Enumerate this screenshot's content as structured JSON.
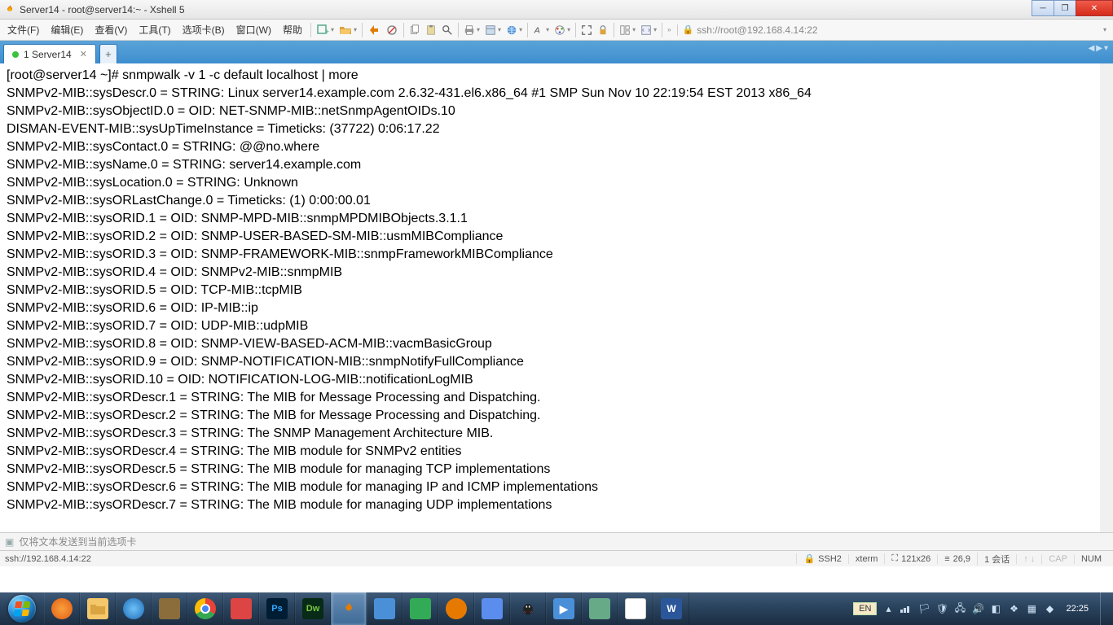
{
  "title": "Server14 - root@server14:~ - Xshell 5",
  "menus": [
    "文件(F)",
    "编辑(E)",
    "查看(V)",
    "工具(T)",
    "选项卡(B)",
    "窗口(W)",
    "帮助"
  ],
  "address": "ssh://root@192.168.4.14:22",
  "tab": {
    "label": "1 Server14"
  },
  "terminal": {
    "prompt": "[root@server14 ~]# ",
    "command": "snmpwalk -v 1 -c default localhost | more",
    "lines": [
      "SNMPv2-MIB::sysDescr.0 = STRING: Linux server14.example.com 2.6.32-431.el6.x86_64 #1 SMP Sun Nov 10 22:19:54 EST 2013 x86_64",
      "SNMPv2-MIB::sysObjectID.0 = OID: NET-SNMP-MIB::netSnmpAgentOIDs.10",
      "DISMAN-EVENT-MIB::sysUpTimeInstance = Timeticks: (37722) 0:06:17.22",
      "SNMPv2-MIB::sysContact.0 = STRING: @@no.where",
      "SNMPv2-MIB::sysName.0 = STRING: server14.example.com",
      "SNMPv2-MIB::sysLocation.0 = STRING: Unknown",
      "SNMPv2-MIB::sysORLastChange.0 = Timeticks: (1) 0:00:00.01",
      "SNMPv2-MIB::sysORID.1 = OID: SNMP-MPD-MIB::snmpMPDMIBObjects.3.1.1",
      "SNMPv2-MIB::sysORID.2 = OID: SNMP-USER-BASED-SM-MIB::usmMIBCompliance",
      "SNMPv2-MIB::sysORID.3 = OID: SNMP-FRAMEWORK-MIB::snmpFrameworkMIBCompliance",
      "SNMPv2-MIB::sysORID.4 = OID: SNMPv2-MIB::snmpMIB",
      "SNMPv2-MIB::sysORID.5 = OID: TCP-MIB::tcpMIB",
      "SNMPv2-MIB::sysORID.6 = OID: IP-MIB::ip",
      "SNMPv2-MIB::sysORID.7 = OID: UDP-MIB::udpMIB",
      "SNMPv2-MIB::sysORID.8 = OID: SNMP-VIEW-BASED-ACM-MIB::vacmBasicGroup",
      "SNMPv2-MIB::sysORID.9 = OID: SNMP-NOTIFICATION-MIB::snmpNotifyFullCompliance",
      "SNMPv2-MIB::sysORID.10 = OID: NOTIFICATION-LOG-MIB::notificationLogMIB",
      "SNMPv2-MIB::sysORDescr.1 = STRING: The MIB for Message Processing and Dispatching.",
      "SNMPv2-MIB::sysORDescr.2 = STRING: The MIB for Message Processing and Dispatching.",
      "SNMPv2-MIB::sysORDescr.3 = STRING: The SNMP Management Architecture MIB.",
      "SNMPv2-MIB::sysORDescr.4 = STRING: The MIB module for SNMPv2 entities",
      "SNMPv2-MIB::sysORDescr.5 = STRING: The MIB module for managing TCP implementations",
      "SNMPv2-MIB::sysORDescr.6 = STRING: The MIB module for managing IP and ICMP implementations",
      "SNMPv2-MIB::sysORDescr.7 = STRING: The MIB module for managing UDP implementations"
    ]
  },
  "sendbar": "仅将文本发送到当前选项卡",
  "status": {
    "conn": "ssh://192.168.4.14:22",
    "proto": "SSH2",
    "term": "xterm",
    "size": "121x26",
    "pos": "26,9",
    "sessions": "1 会话",
    "caps": "CAP",
    "num": "NUM"
  },
  "ime": "EN",
  "clock": "22:25"
}
